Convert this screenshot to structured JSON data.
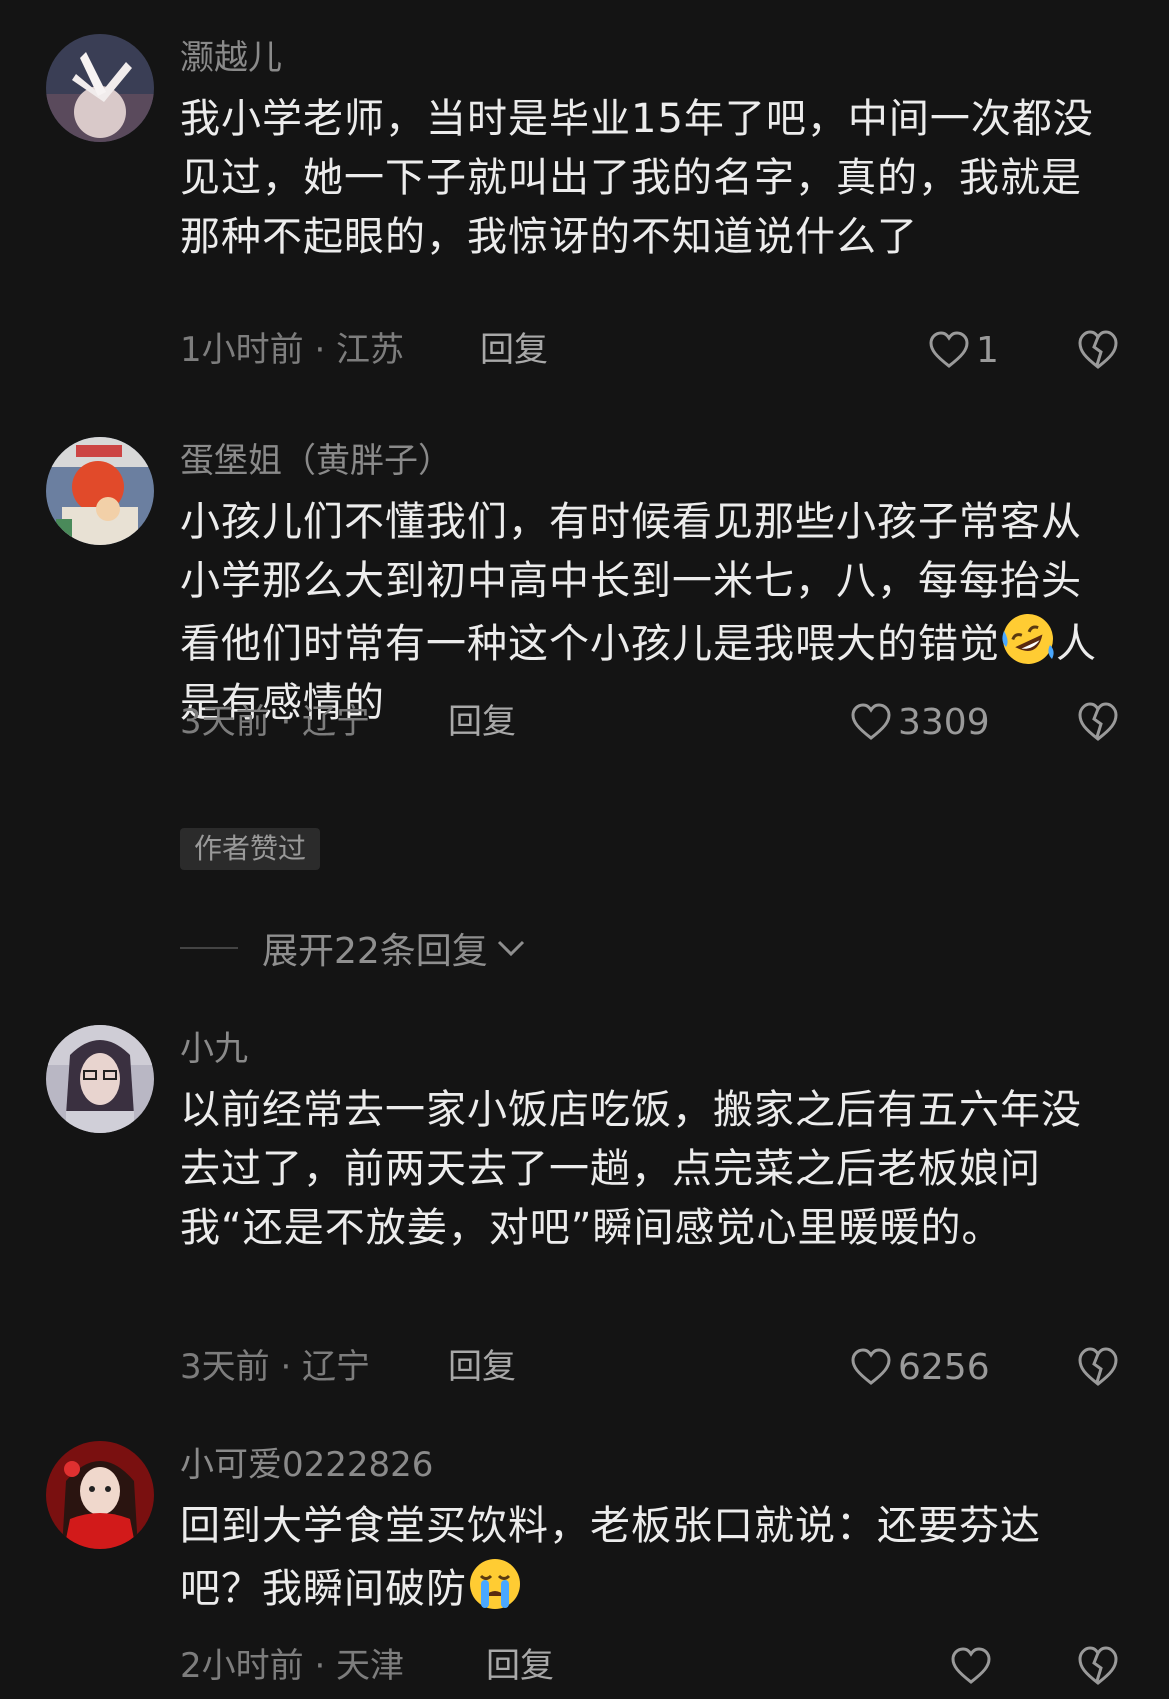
{
  "comments": [
    {
      "username": "灏越儿",
      "text": "我小学老师，当时是毕业15年了吧，中间一次都没见过，她一下子就叫出了我的名字，真的，我就是那种不起眼的，我惊讶的不知道说什么了",
      "meta": "1小时前 · 江苏",
      "reply_label": "回复",
      "likes": "1"
    },
    {
      "username": "蛋堡姐（黄胖子）",
      "text_before_emoji": "小孩儿们不懂我们，有时候看见那些小孩子常客从小学那么大到初中高中长到一米七，八，每每抬头看他们时常有一种这个小孩儿是我喂大的错觉",
      "text_after_emoji": "人是有感情的",
      "emoji": "rolling-laughing-emoji",
      "meta": "3天前 · 辽宁",
      "reply_label": "回复",
      "likes": "3309",
      "badge": "作者赞过",
      "expand_label": "展开22条回复"
    },
    {
      "username": "小九",
      "text": "以前经常去一家小饭店吃饭，搬家之后有五六年没去过了，前两天去了一趟，点完菜之后老板娘问我“还是不放姜，对吧”瞬间感觉心里暖暖的。",
      "meta": "3天前 · 辽宁",
      "reply_label": "回复",
      "likes": "6256"
    },
    {
      "username": "小可爱0222826",
      "text_before_emoji": "回到大学食堂买饮料，老板张口就说：还要芬达吧？我瞬间破防",
      "emoji": "loudly-crying-emoji",
      "meta": "2小时前 · 天津",
      "reply_label": "回复",
      "likes": ""
    }
  ],
  "icons": {
    "like": "heart-outline-icon",
    "dislike": "broken-heart-icon",
    "expand": "chevron-down-icon"
  }
}
